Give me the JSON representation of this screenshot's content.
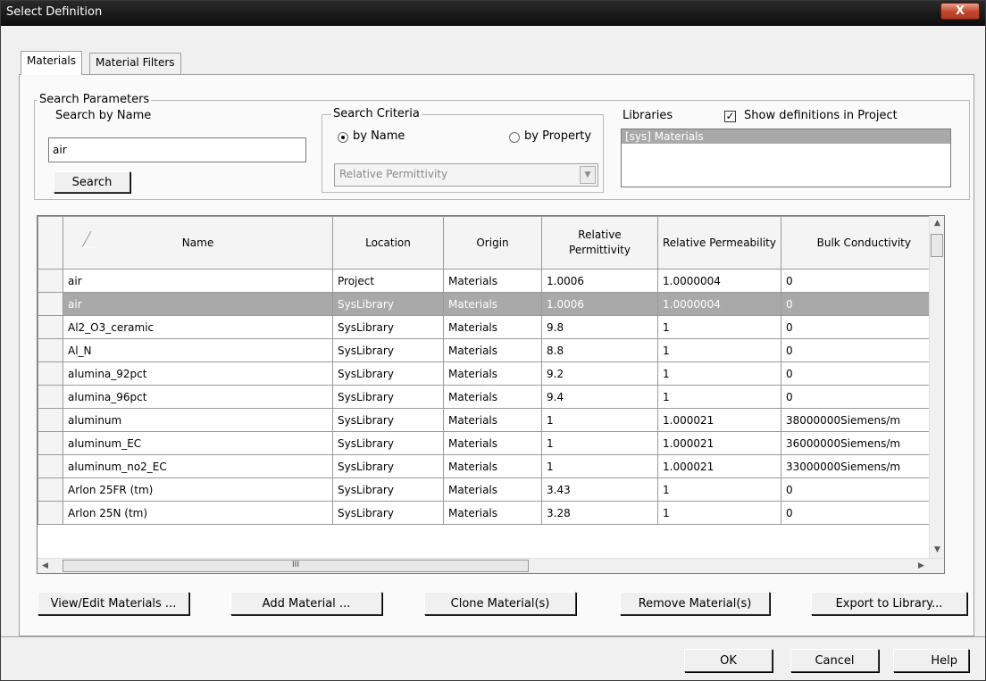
{
  "window": {
    "title": "Select Definition",
    "close_label": "X"
  },
  "tabs": [
    {
      "label": "Materials",
      "active": true
    },
    {
      "label": "Material Filters",
      "active": false
    }
  ],
  "search_parameters": {
    "legend": "Search Parameters",
    "search_by_name_label": "Search by Name",
    "name_value": "air",
    "search_button": "Search"
  },
  "search_criteria": {
    "legend": "Search Criteria",
    "by_name": "by Name",
    "by_property": "by Property",
    "selected": "by Name",
    "property_combo": "Relative Permittivity"
  },
  "libraries": {
    "label": "Libraries",
    "show_definitions_label": "Show definitions in Project",
    "show_definitions_checked": true,
    "items": [
      "[sys] Materials"
    ]
  },
  "grid": {
    "columns": [
      "Name",
      "Location",
      "Origin",
      "Relative Permittivity",
      "Relative Permeability",
      "Bulk Conductivity"
    ],
    "rows": [
      {
        "name": "air",
        "location": "Project",
        "origin": "Materials",
        "permittivity": "1.0006",
        "permeability": "1.0000004",
        "conductivity": "0"
      },
      {
        "name": "air",
        "location": "SysLibrary",
        "origin": "Materials",
        "permittivity": "1.0006",
        "permeability": "1.0000004",
        "conductivity": "0",
        "selected": true
      },
      {
        "name": "Al2_O3_ceramic",
        "location": "SysLibrary",
        "origin": "Materials",
        "permittivity": "9.8",
        "permeability": "1",
        "conductivity": "0"
      },
      {
        "name": "Al_N",
        "location": "SysLibrary",
        "origin": "Materials",
        "permittivity": "8.8",
        "permeability": "1",
        "conductivity": "0"
      },
      {
        "name": "alumina_92pct",
        "location": "SysLibrary",
        "origin": "Materials",
        "permittivity": "9.2",
        "permeability": "1",
        "conductivity": "0"
      },
      {
        "name": "alumina_96pct",
        "location": "SysLibrary",
        "origin": "Materials",
        "permittivity": "9.4",
        "permeability": "1",
        "conductivity": "0"
      },
      {
        "name": "aluminum",
        "location": "SysLibrary",
        "origin": "Materials",
        "permittivity": "1",
        "permeability": "1.000021",
        "conductivity": "38000000Siemens/m"
      },
      {
        "name": "aluminum_EC",
        "location": "SysLibrary",
        "origin": "Materials",
        "permittivity": "1",
        "permeability": "1.000021",
        "conductivity": "36000000Siemens/m"
      },
      {
        "name": "aluminum_no2_EC",
        "location": "SysLibrary",
        "origin": "Materials",
        "permittivity": "1",
        "permeability": "1.000021",
        "conductivity": "33000000Siemens/m"
      },
      {
        "name": "Arlon 25FR (tm)",
        "location": "SysLibrary",
        "origin": "Materials",
        "permittivity": "3.43",
        "permeability": "1",
        "conductivity": "0"
      },
      {
        "name": "Arlon 25N (tm)",
        "location": "SysLibrary",
        "origin": "Materials",
        "permittivity": "3.28",
        "permeability": "1",
        "conductivity": "0"
      }
    ],
    "hscroll_grip": "III"
  },
  "actions": {
    "view_edit": "View/Edit Materials ...",
    "add": "Add Material ...",
    "clone": "Clone Material(s)",
    "remove": "Remove Material(s)",
    "export": "Export to Library..."
  },
  "footer": {
    "ok": "OK",
    "cancel": "Cancel",
    "help": "Help"
  },
  "colors": {
    "selection": "#a9a9a9",
    "titlebar": "#111111",
    "close": "#c4442a"
  }
}
